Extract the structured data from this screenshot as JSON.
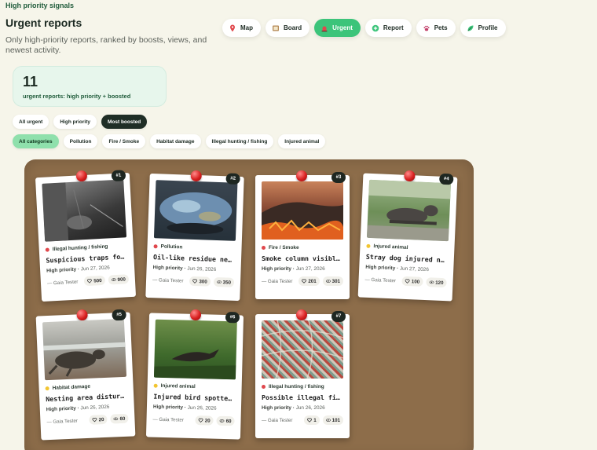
{
  "header": {
    "eyebrow": "High priority signals",
    "title": "Urgent reports",
    "subtitle": "Only high-priority reports, ranked by boosts, views, and newest activity."
  },
  "nav": [
    {
      "label": "Map",
      "icon": "map-pin-icon",
      "active": false
    },
    {
      "label": "Board",
      "icon": "board-icon",
      "active": false
    },
    {
      "label": "Urgent",
      "icon": "alarm-icon",
      "active": true
    },
    {
      "label": "Report",
      "icon": "plus-circle-icon",
      "active": false
    },
    {
      "label": "Pets",
      "icon": "paw-icon",
      "active": false
    },
    {
      "label": "Profile",
      "icon": "leaf-profile-icon",
      "active": false
    }
  ],
  "stats": {
    "count": "11",
    "label": "urgent reports: high priority + boosted"
  },
  "sort_filters": [
    {
      "label": "All urgent",
      "active": false
    },
    {
      "label": "High priority",
      "active": false
    },
    {
      "label": "Most boosted",
      "active": true
    }
  ],
  "category_filters": [
    {
      "label": "All categories",
      "active": true
    },
    {
      "label": "Pollution",
      "active": false
    },
    {
      "label": "Fire / Smoke",
      "active": false
    },
    {
      "label": "Habitat damage",
      "active": false
    },
    {
      "label": "Illegal hunting / fishing",
      "active": false
    },
    {
      "label": "Injured animal",
      "active": false
    }
  ],
  "colors": {
    "accent": "#3cc47a",
    "board": "#8d6d4a",
    "red_dot": "#e0484d",
    "yellow_dot": "#f2c531"
  },
  "cards": [
    {
      "rank": "#1",
      "category": "Illegal hunting / fishing",
      "dot": "red",
      "title": "Suspicious traps found…",
      "priority": "High priority",
      "date": "Jun 27, 2026",
      "author": "— Gaia Tester",
      "likes": "500",
      "views": "900",
      "photo": "trail-cam"
    },
    {
      "rank": "#2",
      "category": "Pollution",
      "dot": "red",
      "title": "Oil-like residue near …",
      "priority": "High priority",
      "date": "Jun 26, 2026",
      "author": "— Gaia Tester",
      "likes": "300",
      "views": "350",
      "photo": "oil"
    },
    {
      "rank": "#3",
      "category": "Fire / Smoke",
      "dot": "red",
      "title": "Smoke column visible n…",
      "priority": "High priority",
      "date": "Jun 27, 2026",
      "author": "— Gaia Tester",
      "likes": "201",
      "views": "301",
      "photo": "fire"
    },
    {
      "rank": "#4",
      "category": "Injured animal",
      "dot": "yellow",
      "title": "Stray dog injured near…",
      "priority": "High priority",
      "date": "Jun 27, 2026",
      "author": "— Gaia Tester",
      "likes": "100",
      "views": "120",
      "photo": "dog"
    },
    {
      "rank": "#5",
      "category": "Habitat damage",
      "dot": "yellow",
      "title": "Nesting area disturbed…",
      "priority": "High priority",
      "date": "Jun 26, 2026",
      "author": "— Gaia Tester",
      "likes": "20",
      "views": "60",
      "photo": "turtle"
    },
    {
      "rank": "#6",
      "category": "Injured animal",
      "dot": "yellow",
      "title": "Injured bird spotted n…",
      "priority": "High priority",
      "date": "Jun 26, 2026",
      "author": "— Gaia Tester",
      "likes": "20",
      "views": "60",
      "photo": "bird"
    },
    {
      "rank": "#7",
      "category": "Illegal hunting / fishing",
      "dot": "red",
      "title": "Possible illegal fishi…",
      "priority": "High priority",
      "date": "Jun 26, 2026",
      "author": "— Gaia Tester",
      "likes": "1",
      "views": "101",
      "photo": "net"
    }
  ]
}
